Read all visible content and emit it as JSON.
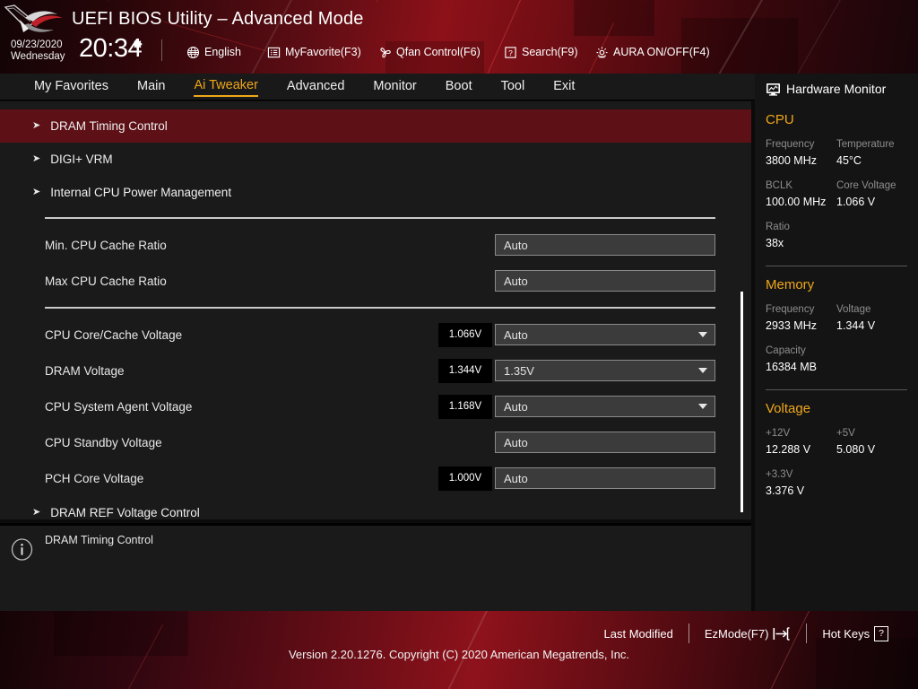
{
  "header": {
    "logo": "rog-logo",
    "title": "UEFI BIOS Utility – Advanced Mode",
    "date": "09/23/2020",
    "weekday": "Wednesday",
    "time": "20:34",
    "gear_icon": "gear-icon",
    "items": [
      {
        "label": "English",
        "icon": "globe-icon"
      },
      {
        "label": "MyFavorite(F3)",
        "icon": "list-icon"
      },
      {
        "label": "Qfan Control(F6)",
        "icon": "fan-icon"
      },
      {
        "label": "Search(F9)",
        "icon": "question-box-icon"
      },
      {
        "label": "AURA ON/OFF(F4)",
        "icon": "aura-icon"
      }
    ]
  },
  "nav": {
    "tabs": [
      {
        "label": "My Favorites",
        "active": false
      },
      {
        "label": "Main",
        "active": false
      },
      {
        "label": "Ai Tweaker",
        "active": true
      },
      {
        "label": "Advanced",
        "active": false
      },
      {
        "label": "Monitor",
        "active": false
      },
      {
        "label": "Boot",
        "active": false
      },
      {
        "label": "Tool",
        "active": false
      },
      {
        "label": "Exit",
        "active": false
      }
    ],
    "active_color": "#f0a719"
  },
  "main": {
    "submenus_top": [
      {
        "label": "DRAM Timing Control",
        "selected": true
      },
      {
        "label": "DIGI+ VRM",
        "selected": false
      },
      {
        "label": "Internal CPU Power Management",
        "selected": false
      }
    ],
    "group1": [
      {
        "label": "Min. CPU Cache Ratio",
        "badge": "",
        "value": "Auto",
        "dropdown": false
      },
      {
        "label": "Max CPU Cache Ratio",
        "badge": "",
        "value": "Auto",
        "dropdown": false
      }
    ],
    "group2": [
      {
        "label": "CPU Core/Cache Voltage",
        "badge": "1.066V",
        "value": "Auto",
        "dropdown": true
      },
      {
        "label": "DRAM Voltage",
        "badge": "1.344V",
        "value": "1.35V",
        "dropdown": true
      },
      {
        "label": "CPU System Agent Voltage",
        "badge": "1.168V",
        "value": "Auto",
        "dropdown": true
      },
      {
        "label": "CPU Standby Voltage",
        "badge": "",
        "value": "Auto",
        "dropdown": false
      },
      {
        "label": "PCH Core Voltage",
        "badge": "1.000V",
        "value": "Auto",
        "dropdown": false
      }
    ],
    "submenus_bottom": [
      {
        "label": "DRAM REF Voltage Control",
        "selected": false
      }
    ],
    "selected_row_color": "#5d1016"
  },
  "info": {
    "icon": "info-circle-icon",
    "text": "DRAM Timing Control"
  },
  "hardware_monitor": {
    "icon": "monitor-icon",
    "title": "Hardware Monitor",
    "sections": [
      {
        "name": "CPU",
        "rows": [
          [
            {
              "key": "Frequency",
              "value": "3800 MHz"
            },
            {
              "key": "Temperature",
              "value": "45°C"
            }
          ],
          [
            {
              "key": "BCLK",
              "value": "100.00 MHz"
            },
            {
              "key": "Core Voltage",
              "value": "1.066 V"
            }
          ],
          [
            {
              "key": "Ratio",
              "value": "38x"
            }
          ]
        ]
      },
      {
        "name": "Memory",
        "rows": [
          [
            {
              "key": "Frequency",
              "value": "2933 MHz"
            },
            {
              "key": "Voltage",
              "value": "1.344 V"
            }
          ],
          [
            {
              "key": "Capacity",
              "value": "16384 MB"
            }
          ]
        ]
      },
      {
        "name": "Voltage",
        "rows": [
          [
            {
              "key": "+12V",
              "value": "12.288 V"
            },
            {
              "key": "+5V",
              "value": "5.080 V"
            }
          ],
          [
            {
              "key": "+3.3V",
              "value": "3.376 V"
            }
          ]
        ]
      }
    ],
    "section_color": "#f0a719"
  },
  "footer": {
    "items": [
      {
        "label": "Last Modified",
        "icon": ""
      },
      {
        "label": "EzMode(F7)",
        "icon": "arrow-into-bracket-icon"
      },
      {
        "label": "Hot Keys",
        "icon": "question-box-icon"
      }
    ],
    "version": "Version 2.20.1276. Copyright (C) 2020 American Megatrends, Inc."
  }
}
